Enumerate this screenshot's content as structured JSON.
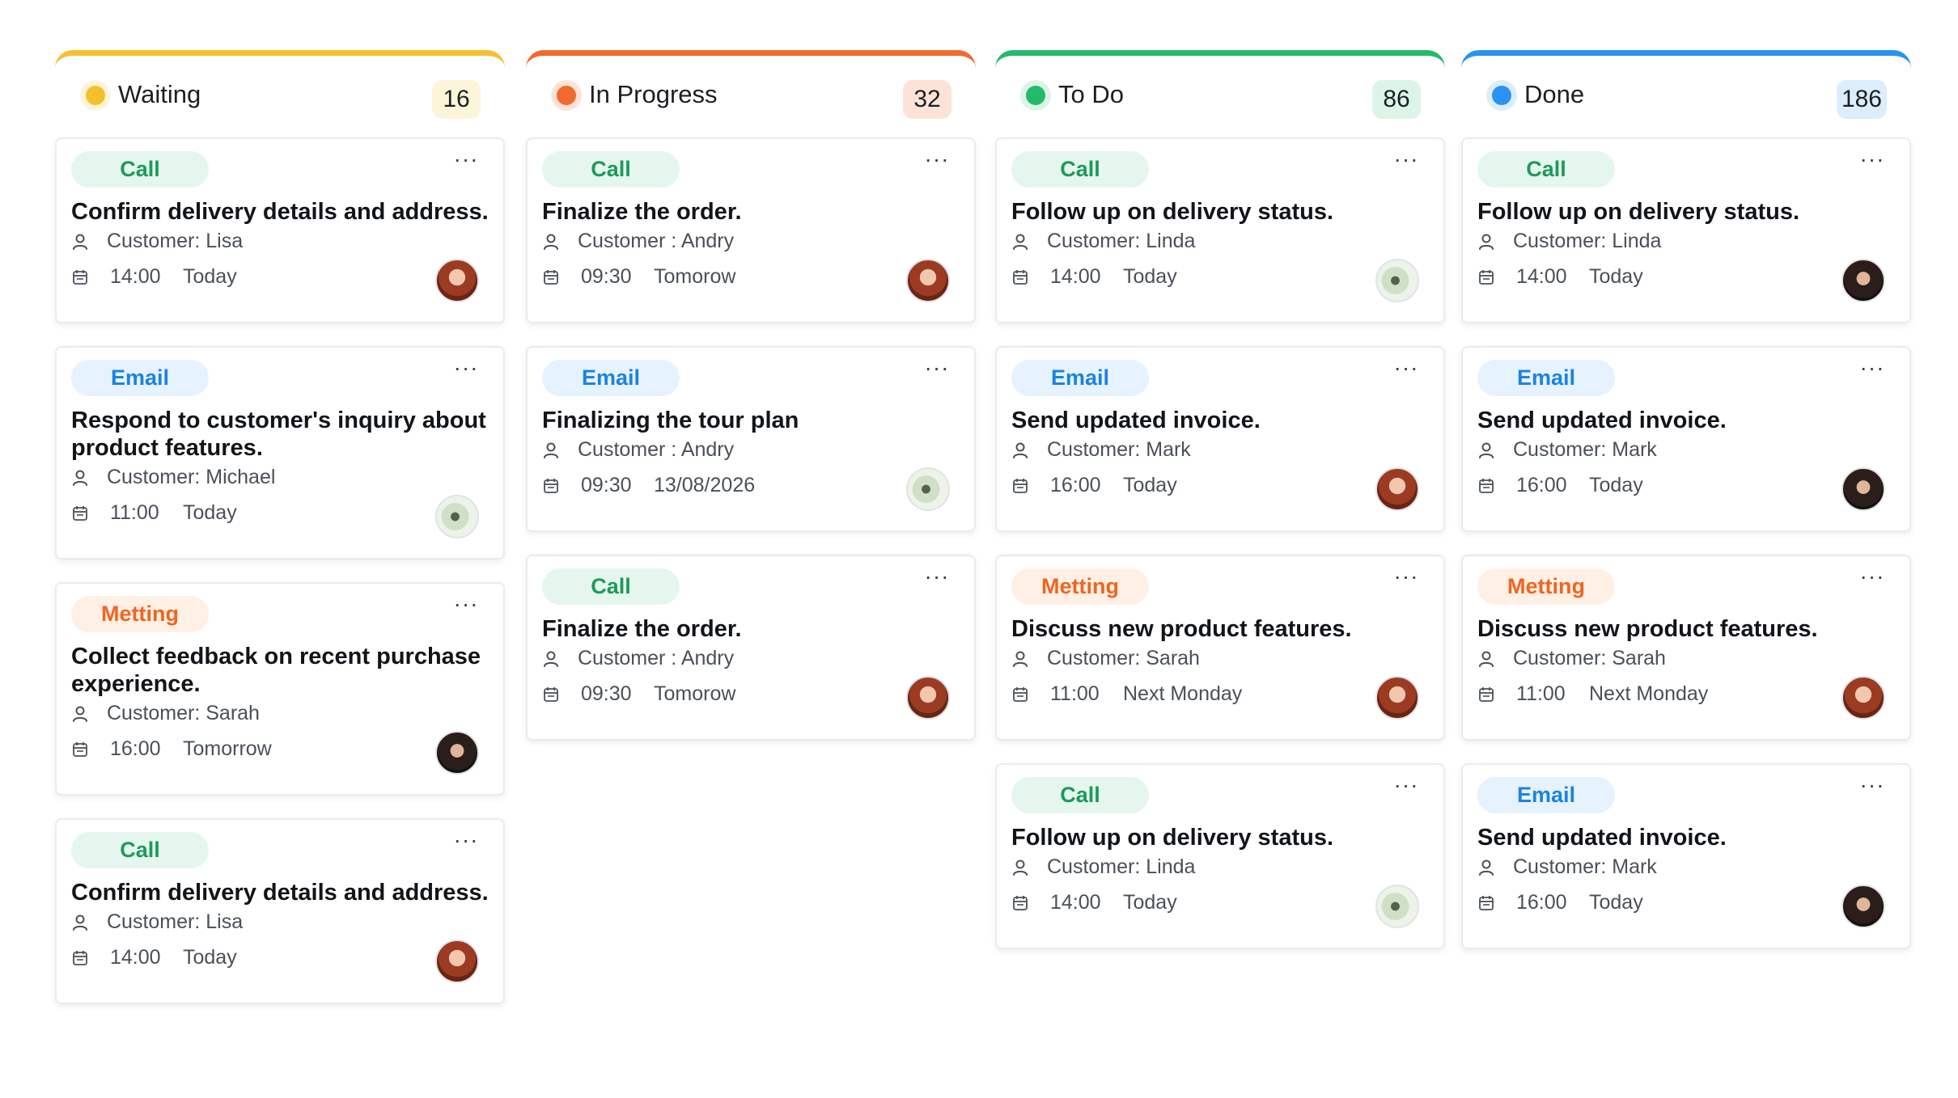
{
  "columns": [
    {
      "title": "Waiting",
      "count": "16",
      "accent": "#f5c02d",
      "accent_soft": "#fdf5da",
      "cards": [
        {
          "tag": "Call",
          "title_lines": [
            "Confirm delivery details and address."
          ],
          "customer": "Customer: Lisa",
          "time": "14:00",
          "when": "Today"
        },
        {
          "tag": "Email",
          "title_lines": [
            "Respond to customer's inquiry about",
            "product features."
          ],
          "customer": "Customer: Michael",
          "time": "11:00",
          "when": "Today"
        },
        {
          "tag": "Metting",
          "title_lines": [
            "Collect feedback on recent purchase",
            "experience."
          ],
          "customer": "Customer: Sarah",
          "time": "16:00",
          "when": "Tomorrow"
        },
        {
          "tag": "Call",
          "title_lines": [
            "Confirm delivery details and address."
          ],
          "customer": "Customer: Lisa",
          "time": "14:00",
          "when": "Today"
        }
      ]
    },
    {
      "title": "In Progress",
      "count": "32",
      "accent": "#f26a2e",
      "accent_soft": "#fde3d7",
      "cards": [
        {
          "tag": "Call",
          "title_lines": [
            "Finalize the order."
          ],
          "customer": "Customer : Andry",
          "time": "09:30",
          "when": "Tomorow"
        },
        {
          "tag": "Email",
          "title_lines": [
            "Finalizing the tour plan"
          ],
          "customer": "Customer : Andry",
          "time": "09:30",
          "when": "13/08/2026"
        },
        {
          "tag": "Call",
          "title_lines": [
            "Finalize the order."
          ],
          "customer": "Customer : Andry",
          "time": "09:30",
          "when": "Tomorow"
        }
      ]
    },
    {
      "title": "To Do",
      "count": "86",
      "accent": "#23ba6a",
      "accent_soft": "#dcf5e8",
      "cards": [
        {
          "tag": "Call",
          "title_lines": [
            "Follow up on delivery status."
          ],
          "customer": "Customer: Linda",
          "time": "14:00",
          "when": "Today"
        },
        {
          "tag": "Email",
          "title_lines": [
            "Send updated invoice."
          ],
          "customer": "Customer: Mark",
          "time": "16:00",
          "when": "Today"
        },
        {
          "tag": "Metting",
          "title_lines": [
            "Discuss new product features."
          ],
          "customer": "Customer: Sarah",
          "time": "11:00",
          "when": "Next Monday"
        },
        {
          "tag": "Call",
          "title_lines": [
            "Follow up on delivery status."
          ],
          "customer": "Customer: Linda",
          "time": "14:00",
          "when": "Today"
        }
      ]
    },
    {
      "title": "Done",
      "count": "186",
      "accent": "#2a92f0",
      "accent_soft": "#dcedfd",
      "cards": [
        {
          "tag": "Call",
          "title_lines": [
            "Follow up on delivery status."
          ],
          "customer": "Customer: Linda",
          "time": "14:00",
          "when": "Today"
        },
        {
          "tag": "Email",
          "title_lines": [
            "Send updated invoice."
          ],
          "customer": "Customer: Mark",
          "time": "16:00",
          "when": "Today"
        },
        {
          "tag": "Metting",
          "title_lines": [
            "Discuss new product features."
          ],
          "customer": "Customer: Sarah",
          "time": "11:00",
          "when": "Next Monday"
        },
        {
          "tag": "Email",
          "title_lines": [
            "Send updated invoice."
          ],
          "customer": "Customer: Mark",
          "time": "16:00",
          "when": "Today"
        }
      ]
    }
  ],
  "more_label": "···"
}
